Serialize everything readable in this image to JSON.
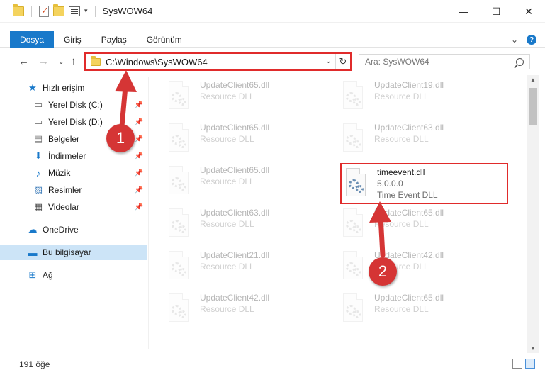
{
  "window": {
    "title": "SysWOW64",
    "controls": {
      "minimize": "—",
      "maximize": "☐",
      "close": "✕"
    }
  },
  "ribbon": {
    "tabs": [
      {
        "label": "Dosya",
        "active": true
      },
      {
        "label": "Giriş",
        "active": false
      },
      {
        "label": "Paylaş",
        "active": false
      },
      {
        "label": "Görünüm",
        "active": false
      }
    ],
    "expand_chevron": "⌄",
    "help": "?"
  },
  "nav": {
    "back": "←",
    "forward": "→",
    "recent": "⌄",
    "up": "↑"
  },
  "address": {
    "path": "C:\\Windows\\SysWOW64",
    "dropdown": "⌄",
    "refresh": "↻"
  },
  "search": {
    "placeholder": "Ara: SysWOW64"
  },
  "sidebar": {
    "items": [
      {
        "label": "Hızlı erişim",
        "icon": "star-icon",
        "pinned": false
      },
      {
        "label": "Yerel Disk (C:)",
        "icon": "drive-icon",
        "pinned": true
      },
      {
        "label": "Yerel Disk (D:)",
        "icon": "drive-icon",
        "pinned": true
      },
      {
        "label": "Belgeler",
        "icon": "document-icon",
        "pinned": true
      },
      {
        "label": "İndirmeler",
        "icon": "download-icon",
        "pinned": true
      },
      {
        "label": "Müzik",
        "icon": "music-icon",
        "pinned": true
      },
      {
        "label": "Resimler",
        "icon": "pictures-icon",
        "pinned": true
      },
      {
        "label": "Videolar",
        "icon": "video-icon",
        "pinned": true
      },
      {
        "label": "OneDrive",
        "icon": "cloud-icon",
        "pinned": false
      },
      {
        "label": "Bu bilgisayar",
        "icon": "computer-icon",
        "pinned": false,
        "selected": true
      },
      {
        "label": "Ağ",
        "icon": "network-icon",
        "pinned": false
      }
    ],
    "pin_glyph": "📌"
  },
  "files": [
    {
      "name": "UpdateClient65.dll",
      "sub": "Resource DLL"
    },
    {
      "name": "UpdateClient19.dll",
      "sub": "Resource DLL"
    },
    {
      "name": "UpdateClient65.dll",
      "sub": "Resource DLL"
    },
    {
      "name": "UpdateClient63.dll",
      "sub": "Resource DLL"
    },
    {
      "name": "UpdateClient65.dll",
      "sub": "Resource DLL"
    },
    {
      "name": "timeevent.dll",
      "version": "5.0.0.0",
      "sub": "Time Event DLL",
      "highlight": true
    },
    {
      "name": "UpdateClient63.dll",
      "sub": "Resource DLL"
    },
    {
      "name": "UpdateClient65.dll",
      "sub": "Resource DLL"
    },
    {
      "name": "UpdateClient21.dll",
      "sub": "Resource DLL"
    },
    {
      "name": "UpdateClient42.dll",
      "sub": "Resource DLL"
    },
    {
      "name": "UpdateClient42.dll",
      "sub": "Resource DLL"
    },
    {
      "name": "UpdateClient65.dll",
      "sub": "Resource DLL"
    }
  ],
  "status": {
    "count": "191 öğe"
  },
  "annotations": {
    "step1": "1",
    "step2": "2",
    "color": "#d53535"
  }
}
